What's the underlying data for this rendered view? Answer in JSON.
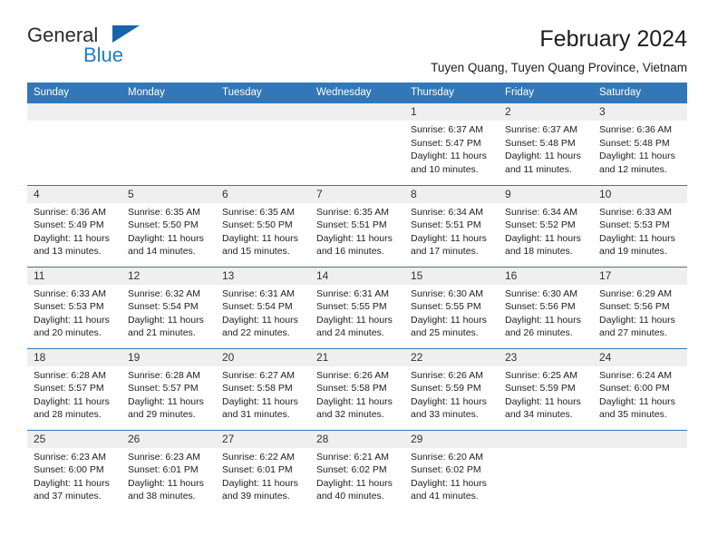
{
  "brand": {
    "name_part1": "General",
    "name_part2": "Blue",
    "triangle_icon": "blue-triangle-logo-mark",
    "accent_color": "#1f7ec4"
  },
  "header": {
    "title": "February 2024",
    "subtitle": "Tuyen Quang, Tuyen Quang Province, Vietnam"
  },
  "colors": {
    "header_blue": "#3277b8",
    "daynum_gray": "#efefef",
    "text": "#1d1d1d"
  },
  "weekday_headers": [
    "Sunday",
    "Monday",
    "Tuesday",
    "Wednesday",
    "Thursday",
    "Friday",
    "Saturday"
  ],
  "labels": {
    "sunrise_prefix": "Sunrise: ",
    "sunset_prefix": "Sunset: ",
    "daylight_prefix": "Daylight: "
  },
  "weeks": [
    [
      {
        "day": "",
        "sunrise": "",
        "sunset": "",
        "daylight_line1": "",
        "daylight_line2": ""
      },
      {
        "day": "",
        "sunrise": "",
        "sunset": "",
        "daylight_line1": "",
        "daylight_line2": ""
      },
      {
        "day": "",
        "sunrise": "",
        "sunset": "",
        "daylight_line1": "",
        "daylight_line2": ""
      },
      {
        "day": "",
        "sunrise": "",
        "sunset": "",
        "daylight_line1": "",
        "daylight_line2": ""
      },
      {
        "day": "1",
        "sunrise": "Sunrise: 6:37 AM",
        "sunset": "Sunset: 5:47 PM",
        "daylight_line1": "Daylight: 11 hours",
        "daylight_line2": "and 10 minutes."
      },
      {
        "day": "2",
        "sunrise": "Sunrise: 6:37 AM",
        "sunset": "Sunset: 5:48 PM",
        "daylight_line1": "Daylight: 11 hours",
        "daylight_line2": "and 11 minutes."
      },
      {
        "day": "3",
        "sunrise": "Sunrise: 6:36 AM",
        "sunset": "Sunset: 5:48 PM",
        "daylight_line1": "Daylight: 11 hours",
        "daylight_line2": "and 12 minutes."
      }
    ],
    [
      {
        "day": "4",
        "sunrise": "Sunrise: 6:36 AM",
        "sunset": "Sunset: 5:49 PM",
        "daylight_line1": "Daylight: 11 hours",
        "daylight_line2": "and 13 minutes."
      },
      {
        "day": "5",
        "sunrise": "Sunrise: 6:35 AM",
        "sunset": "Sunset: 5:50 PM",
        "daylight_line1": "Daylight: 11 hours",
        "daylight_line2": "and 14 minutes."
      },
      {
        "day": "6",
        "sunrise": "Sunrise: 6:35 AM",
        "sunset": "Sunset: 5:50 PM",
        "daylight_line1": "Daylight: 11 hours",
        "daylight_line2": "and 15 minutes."
      },
      {
        "day": "7",
        "sunrise": "Sunrise: 6:35 AM",
        "sunset": "Sunset: 5:51 PM",
        "daylight_line1": "Daylight: 11 hours",
        "daylight_line2": "and 16 minutes."
      },
      {
        "day": "8",
        "sunrise": "Sunrise: 6:34 AM",
        "sunset": "Sunset: 5:51 PM",
        "daylight_line1": "Daylight: 11 hours",
        "daylight_line2": "and 17 minutes."
      },
      {
        "day": "9",
        "sunrise": "Sunrise: 6:34 AM",
        "sunset": "Sunset: 5:52 PM",
        "daylight_line1": "Daylight: 11 hours",
        "daylight_line2": "and 18 minutes."
      },
      {
        "day": "10",
        "sunrise": "Sunrise: 6:33 AM",
        "sunset": "Sunset: 5:53 PM",
        "daylight_line1": "Daylight: 11 hours",
        "daylight_line2": "and 19 minutes."
      }
    ],
    [
      {
        "day": "11",
        "sunrise": "Sunrise: 6:33 AM",
        "sunset": "Sunset: 5:53 PM",
        "daylight_line1": "Daylight: 11 hours",
        "daylight_line2": "and 20 minutes."
      },
      {
        "day": "12",
        "sunrise": "Sunrise: 6:32 AM",
        "sunset": "Sunset: 5:54 PM",
        "daylight_line1": "Daylight: 11 hours",
        "daylight_line2": "and 21 minutes."
      },
      {
        "day": "13",
        "sunrise": "Sunrise: 6:31 AM",
        "sunset": "Sunset: 5:54 PM",
        "daylight_line1": "Daylight: 11 hours",
        "daylight_line2": "and 22 minutes."
      },
      {
        "day": "14",
        "sunrise": "Sunrise: 6:31 AM",
        "sunset": "Sunset: 5:55 PM",
        "daylight_line1": "Daylight: 11 hours",
        "daylight_line2": "and 24 minutes."
      },
      {
        "day": "15",
        "sunrise": "Sunrise: 6:30 AM",
        "sunset": "Sunset: 5:55 PM",
        "daylight_line1": "Daylight: 11 hours",
        "daylight_line2": "and 25 minutes."
      },
      {
        "day": "16",
        "sunrise": "Sunrise: 6:30 AM",
        "sunset": "Sunset: 5:56 PM",
        "daylight_line1": "Daylight: 11 hours",
        "daylight_line2": "and 26 minutes."
      },
      {
        "day": "17",
        "sunrise": "Sunrise: 6:29 AM",
        "sunset": "Sunset: 5:56 PM",
        "daylight_line1": "Daylight: 11 hours",
        "daylight_line2": "and 27 minutes."
      }
    ],
    [
      {
        "day": "18",
        "sunrise": "Sunrise: 6:28 AM",
        "sunset": "Sunset: 5:57 PM",
        "daylight_line1": "Daylight: 11 hours",
        "daylight_line2": "and 28 minutes."
      },
      {
        "day": "19",
        "sunrise": "Sunrise: 6:28 AM",
        "sunset": "Sunset: 5:57 PM",
        "daylight_line1": "Daylight: 11 hours",
        "daylight_line2": "and 29 minutes."
      },
      {
        "day": "20",
        "sunrise": "Sunrise: 6:27 AM",
        "sunset": "Sunset: 5:58 PM",
        "daylight_line1": "Daylight: 11 hours",
        "daylight_line2": "and 31 minutes."
      },
      {
        "day": "21",
        "sunrise": "Sunrise: 6:26 AM",
        "sunset": "Sunset: 5:58 PM",
        "daylight_line1": "Daylight: 11 hours",
        "daylight_line2": "and 32 minutes."
      },
      {
        "day": "22",
        "sunrise": "Sunrise: 6:26 AM",
        "sunset": "Sunset: 5:59 PM",
        "daylight_line1": "Daylight: 11 hours",
        "daylight_line2": "and 33 minutes."
      },
      {
        "day": "23",
        "sunrise": "Sunrise: 6:25 AM",
        "sunset": "Sunset: 5:59 PM",
        "daylight_line1": "Daylight: 11 hours",
        "daylight_line2": "and 34 minutes."
      },
      {
        "day": "24",
        "sunrise": "Sunrise: 6:24 AM",
        "sunset": "Sunset: 6:00 PM",
        "daylight_line1": "Daylight: 11 hours",
        "daylight_line2": "and 35 minutes."
      }
    ],
    [
      {
        "day": "25",
        "sunrise": "Sunrise: 6:23 AM",
        "sunset": "Sunset: 6:00 PM",
        "daylight_line1": "Daylight: 11 hours",
        "daylight_line2": "and 37 minutes."
      },
      {
        "day": "26",
        "sunrise": "Sunrise: 6:23 AM",
        "sunset": "Sunset: 6:01 PM",
        "daylight_line1": "Daylight: 11 hours",
        "daylight_line2": "and 38 minutes."
      },
      {
        "day": "27",
        "sunrise": "Sunrise: 6:22 AM",
        "sunset": "Sunset: 6:01 PM",
        "daylight_line1": "Daylight: 11 hours",
        "daylight_line2": "and 39 minutes."
      },
      {
        "day": "28",
        "sunrise": "Sunrise: 6:21 AM",
        "sunset": "Sunset: 6:02 PM",
        "daylight_line1": "Daylight: 11 hours",
        "daylight_line2": "and 40 minutes."
      },
      {
        "day": "29",
        "sunrise": "Sunrise: 6:20 AM",
        "sunset": "Sunset: 6:02 PM",
        "daylight_line1": "Daylight: 11 hours",
        "daylight_line2": "and 41 minutes."
      },
      {
        "day": "",
        "sunrise": "",
        "sunset": "",
        "daylight_line1": "",
        "daylight_line2": ""
      },
      {
        "day": "",
        "sunrise": "",
        "sunset": "",
        "daylight_line1": "",
        "daylight_line2": ""
      }
    ]
  ]
}
